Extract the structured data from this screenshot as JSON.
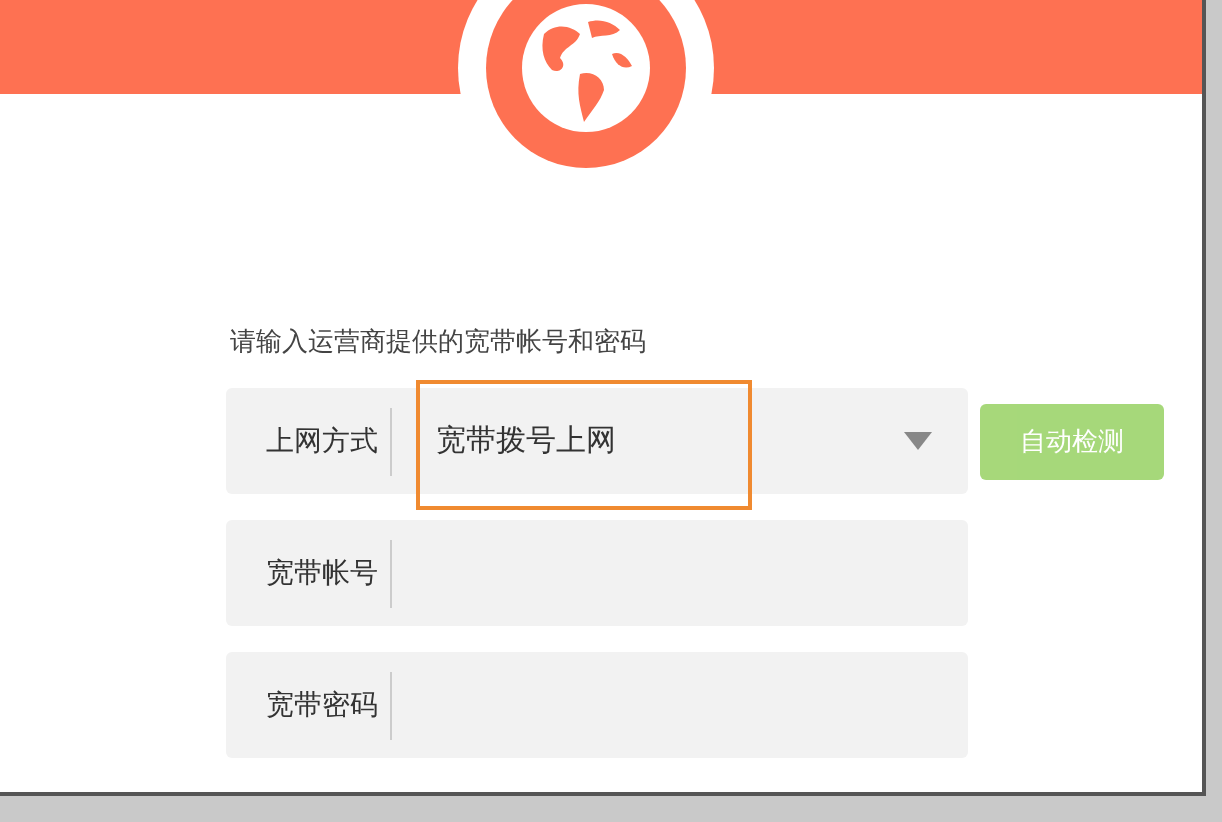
{
  "prompt": "请输入运营商提供的宽带帐号和密码",
  "fields": [
    {
      "kind": "select",
      "label": "上网方式",
      "value": "宽带拨号上网",
      "highlighted": true
    },
    {
      "kind": "input",
      "label": "宽带帐号"
    },
    {
      "kind": "input",
      "label": "宽带密码"
    }
  ],
  "detect_button": {
    "label": "自动检测",
    "disabled": true
  }
}
